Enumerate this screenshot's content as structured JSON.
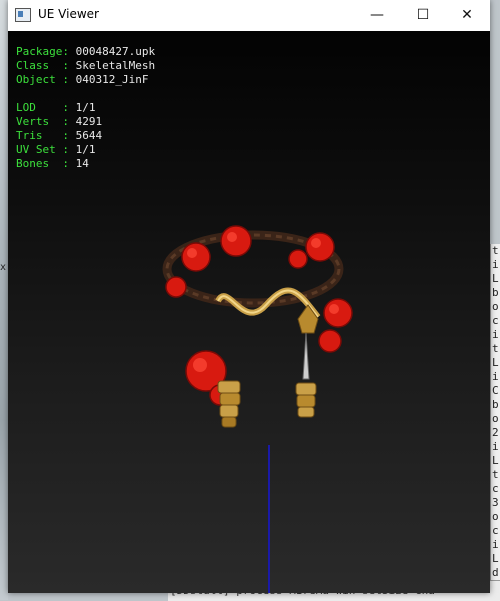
{
  "window": {
    "title": "UE Viewer",
    "minimize_glyph": "—",
    "maximize_glyph": "☐",
    "close_glyph": "✕"
  },
  "info": {
    "package_label": "Package:",
    "package_value": "00048427.upk",
    "class_label": "Class  :",
    "class_value": "SkeletalMesh",
    "object_label": "Object :",
    "object_value": "040312_JinF",
    "lod_label": "LOD    :",
    "lod_value": "1/1",
    "verts_label": "Verts  :",
    "verts_value": "4291",
    "tris_label": "Tris   :",
    "tris_value": "5644",
    "uvset_label": "UV Set :",
    "uvset_value": "1/1",
    "bones_label": "Bones  :",
    "bones_value": "14"
  },
  "background_console": {
    "side_fragments": [
      "t",
      "i",
      "L",
      "b",
      "o",
      "c",
      "i",
      "t",
      "L",
      "i",
      "C",
      "b",
      "o",
      "2",
      "i",
      "L",
      "t",
      "c",
      "3",
      "o",
      "c",
      "i",
      "L",
      "d",
      "c"
    ],
    "bottom_text": "[DDstdll] process  MIreMa win setSize  cha"
  },
  "desktop": {
    "marker": "x"
  },
  "colors": {
    "label_green": "#3ce03c",
    "value_white": "#e8e8e8",
    "axis_blue": "#1a1aa8",
    "rose_red": "#d81a10",
    "gold": "#c9a048"
  },
  "icons": {
    "app": "window-app-icon",
    "minimize": "minimize-icon",
    "maximize": "maximize-icon",
    "close": "close-icon"
  }
}
